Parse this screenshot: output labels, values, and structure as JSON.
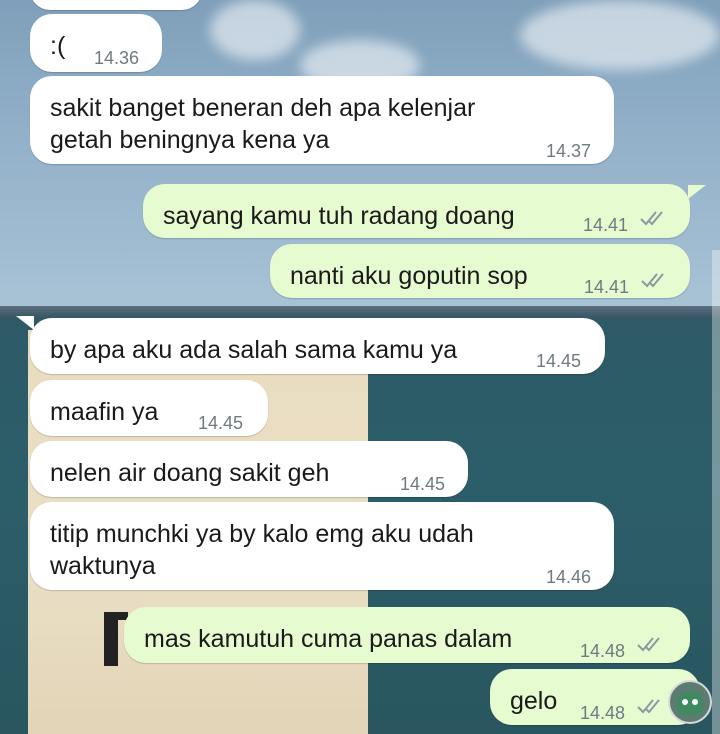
{
  "messages": [
    {
      "id": "m1",
      "side": "in",
      "text": ":(",
      "time": "14.36"
    },
    {
      "id": "m2",
      "side": "in",
      "text": "sakit banget beneran deh apa kelenjar\ngetah beningnya kena ya",
      "time": "14.37"
    },
    {
      "id": "m3",
      "side": "out",
      "text": "sayang kamu tuh radang doang",
      "time": "14.41",
      "status": "read"
    },
    {
      "id": "m4",
      "side": "out",
      "text": "nanti aku goputin sop",
      "time": "14.41",
      "status": "read"
    },
    {
      "id": "m5",
      "side": "in",
      "text": "by apa aku ada salah sama kamu ya",
      "time": "14.45"
    },
    {
      "id": "m6",
      "side": "in",
      "text": "maafin ya",
      "time": "14.45"
    },
    {
      "id": "m7",
      "side": "in",
      "text": "nelen air doang sakit geh",
      "time": "14.45"
    },
    {
      "id": "m8",
      "side": "in",
      "text": "titip munchki ya by kalo emg aku udah\nwaktunya",
      "time": "14.46"
    },
    {
      "id": "m9",
      "side": "out",
      "text": "mas kamutuh cuma panas dalam",
      "time": "14.48",
      "status": "read"
    },
    {
      "id": "m10",
      "side": "out",
      "text": "gelo",
      "time": "14.48",
      "status": "read"
    }
  ],
  "colors": {
    "incoming_bubble": "#ffffff",
    "outgoing_bubble": "#e6fbd0",
    "timestamp": "#6f7b80",
    "read_ticks": "#8a9aa0"
  },
  "icons": {
    "read_receipt": "double-check-icon",
    "sticker": "robot-sticker-icon"
  }
}
